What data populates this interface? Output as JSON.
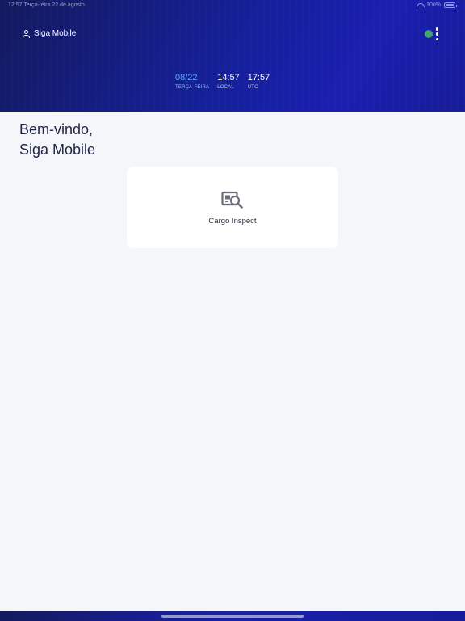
{
  "status_bar": {
    "left_text": "12:57   Terça-feira 22 de agosto",
    "battery_text": "100%"
  },
  "header": {
    "user_name": "Siga Mobile",
    "connection_color": "#3fa66b",
    "clock": [
      {
        "value": "08/22",
        "label": "TERÇA-FEIRA"
      },
      {
        "value": "14:57",
        "label": "LOCAL"
      },
      {
        "value": "17:57",
        "label": "UTC"
      }
    ]
  },
  "main": {
    "welcome_line1": "Bem-vindo,",
    "welcome_line2": "Siga Mobile",
    "modules": [
      {
        "label": "Cargo Inspect",
        "icon": "cargo-inspect-icon"
      }
    ]
  },
  "colors": {
    "header_gradient_start": "#141a5e",
    "header_gradient_end": "#1a1fb0",
    "date_accent": "#5fa8ff",
    "background": "#f5f6fa"
  }
}
